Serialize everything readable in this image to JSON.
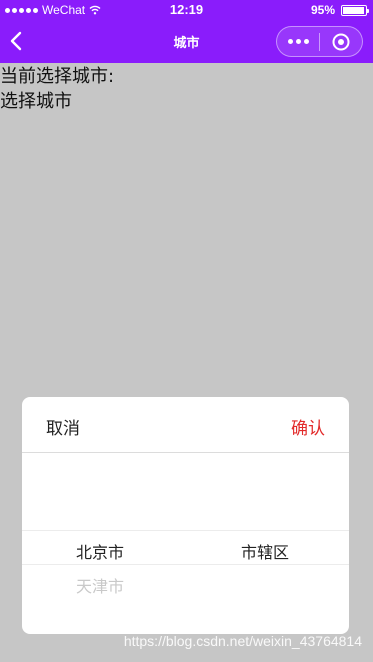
{
  "status_bar": {
    "carrier": "WeChat",
    "time": "12:19",
    "battery": "95%",
    "battery_level": 0.95
  },
  "nav": {
    "title": "城市",
    "back_icon": "chevron-left-icon",
    "more_icon": "more-dots-icon",
    "close_icon": "target-circle-icon"
  },
  "content": {
    "label": "当前选择城市:",
    "value": "选择城市"
  },
  "picker": {
    "cancel_label": "取消",
    "confirm_label": "确认",
    "columns": [
      {
        "selected": "北京市",
        "next": "天津市"
      },
      {
        "selected": "市辖区",
        "next": ""
      }
    ]
  },
  "watermark": "https://blog.csdn.net/weixin_43764814",
  "colors": {
    "brand": "#8a1cfb",
    "confirm": "#e22a2a",
    "background": "#c6c6c6"
  }
}
